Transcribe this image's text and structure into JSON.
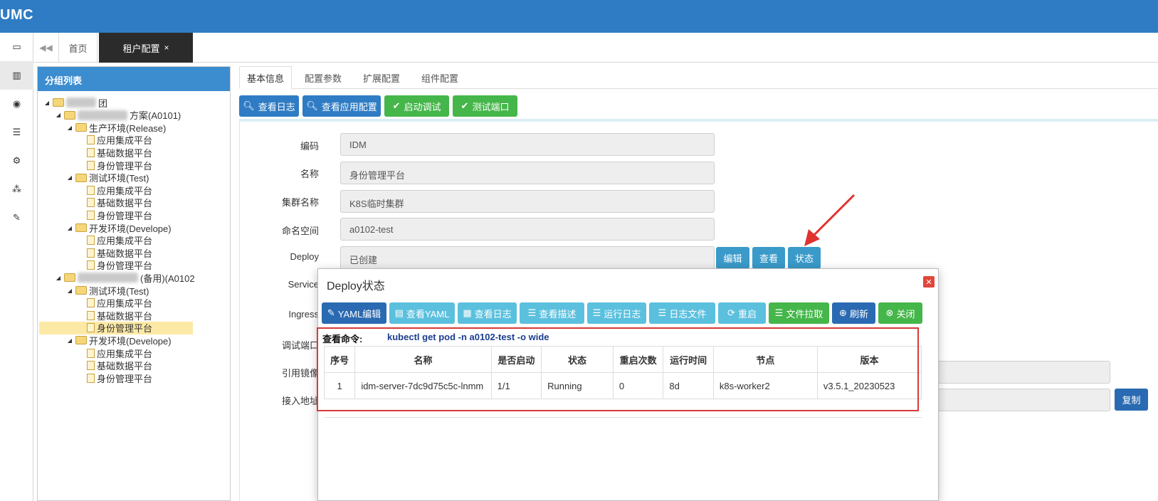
{
  "app": {
    "brand": "UMC"
  },
  "tabs": {
    "home": "首页",
    "current": "租户配置",
    "close": "×"
  },
  "tree": {
    "header": "分组列表",
    "rows": [
      {
        "label": "团",
        "indent": 0,
        "kind": "folder",
        "blur": 42
      },
      {
        "label": "方案(A0101)",
        "indent": 1,
        "kind": "folder",
        "blur": 70
      },
      {
        "label": "生产环境(Release)",
        "indent": 2,
        "kind": "folder"
      },
      {
        "label": "应用集成平台",
        "indent": 3,
        "kind": "page"
      },
      {
        "label": "基础数据平台",
        "indent": 3,
        "kind": "page"
      },
      {
        "label": "身份管理平台",
        "indent": 3,
        "kind": "page"
      },
      {
        "label": "测试环境(Test)",
        "indent": 2,
        "kind": "folder"
      },
      {
        "label": "应用集成平台",
        "indent": 3,
        "kind": "page"
      },
      {
        "label": "基础数据平台",
        "indent": 3,
        "kind": "page"
      },
      {
        "label": "身份管理平台",
        "indent": 3,
        "kind": "page"
      },
      {
        "label": "开发环境(Develope)",
        "indent": 2,
        "kind": "folder"
      },
      {
        "label": "应用集成平台",
        "indent": 3,
        "kind": "page"
      },
      {
        "label": "基础数据平台",
        "indent": 3,
        "kind": "page"
      },
      {
        "label": "身份管理平台",
        "indent": 3,
        "kind": "page"
      },
      {
        "label": "(备用)(A0102",
        "indent": 1,
        "kind": "folder",
        "blur": 85
      },
      {
        "label": "测试环境(Test)",
        "indent": 2,
        "kind": "folder"
      },
      {
        "label": "应用集成平台",
        "indent": 3,
        "kind": "page"
      },
      {
        "label": "基础数据平台",
        "indent": 3,
        "kind": "page"
      },
      {
        "label": "身份管理平台",
        "indent": 3,
        "kind": "page",
        "selected": true
      },
      {
        "label": "开发环境(Develope)",
        "indent": 2,
        "kind": "folder"
      },
      {
        "label": "应用集成平台",
        "indent": 3,
        "kind": "page"
      },
      {
        "label": "基础数据平台",
        "indent": 3,
        "kind": "page"
      },
      {
        "label": "身份管理平台",
        "indent": 3,
        "kind": "page"
      }
    ]
  },
  "subtabs": [
    "基本信息",
    "配置参数",
    "扩展配置",
    "组件配置"
  ],
  "toolbar": {
    "view_log": "查看日志",
    "view_app_config": "查看应用配置",
    "start_debug": "启动调试",
    "test_port": "测试端口"
  },
  "form": {
    "code_label": "编码",
    "code_value": "IDM",
    "name_label": "名称",
    "name_value": "身份管理平台",
    "cluster_label": "集群名称",
    "cluster_value": "K8S临时集群",
    "namespace_label": "命名空间",
    "namespace_value": "a0102-test",
    "deploy_label": "Deploy",
    "deploy_value": "已创建",
    "service_label": "Service",
    "ingress_label": "Ingress",
    "debug_port_label": "调试端口",
    "image_label": "引用镜像",
    "access_label": "接入地址",
    "edit_btn": "编辑",
    "view_btn": "查看",
    "status_btn": "状态",
    "copy_btn": "复制"
  },
  "modal": {
    "title": "Deploy状态",
    "buttons": {
      "yaml_edit": "YAML编辑",
      "view_yaml": "查看YAML",
      "view_log": "查看日志",
      "view_desc": "查看描述",
      "run_log": "运行日志",
      "log_file": "日志文件",
      "restart": "重启",
      "file_pull": "文件拉取",
      "refresh": "刷新",
      "close": "关闭"
    },
    "cmd_label": "查看命令:",
    "cmd": "kubectl get pod -n a0102-test -o wide",
    "table": {
      "headers": [
        "序号",
        "名称",
        "是否启动",
        "状态",
        "重启次数",
        "运行时间",
        "节点",
        "版本"
      ],
      "rows": [
        [
          "1",
          "idm-server-7dc9d75c5c-lnmm",
          "1/1",
          "Running",
          "0",
          "8d",
          "k8s-worker2",
          "v3.5.1_20230523"
        ]
      ]
    }
  },
  "colors": {
    "primary": "#2f7cc4",
    "success": "#45b64a",
    "info": "#5bc0de",
    "danger": "#d9393a"
  }
}
